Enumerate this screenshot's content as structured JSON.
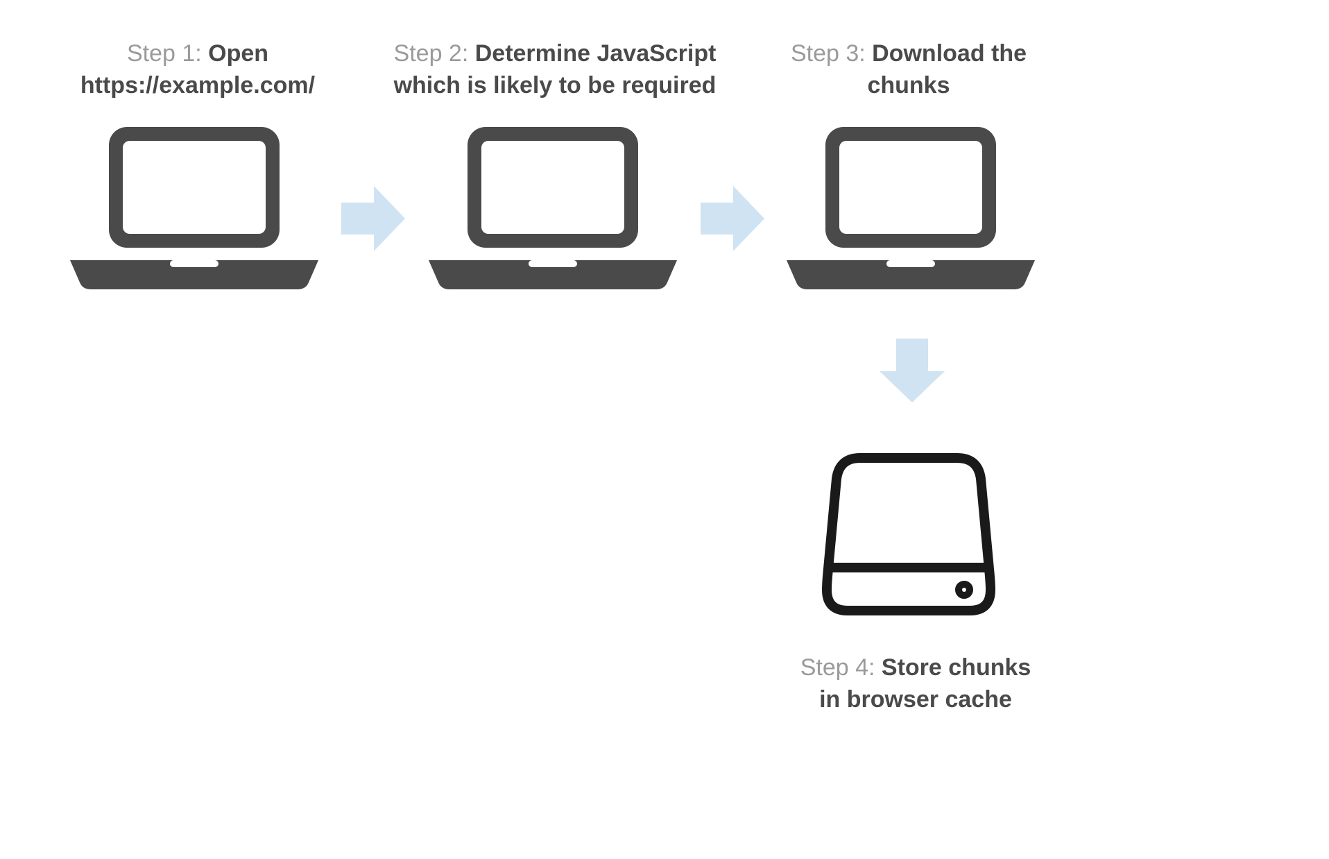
{
  "steps": [
    {
      "prefix": "Step 1: ",
      "bold_line1": "Open",
      "bold_line2": "https://example.com/"
    },
    {
      "prefix": "Step 2: ",
      "bold_line1": "Determine JavaScript",
      "bold_line2": "which is likely to be required"
    },
    {
      "prefix": "Step 3: ",
      "bold_line1": "Download the",
      "bold_line2": "chunks"
    },
    {
      "prefix": "Step 4: ",
      "bold_line1": "Store chunks",
      "bold_line2": "in browser cache"
    }
  ],
  "colors": {
    "laptop": "#4a4a4a",
    "arrow": "#cfe3f2",
    "disk": "#1a1a1a",
    "text_prefix": "#9a9a9a",
    "text_bold": "#4a4a4a"
  }
}
